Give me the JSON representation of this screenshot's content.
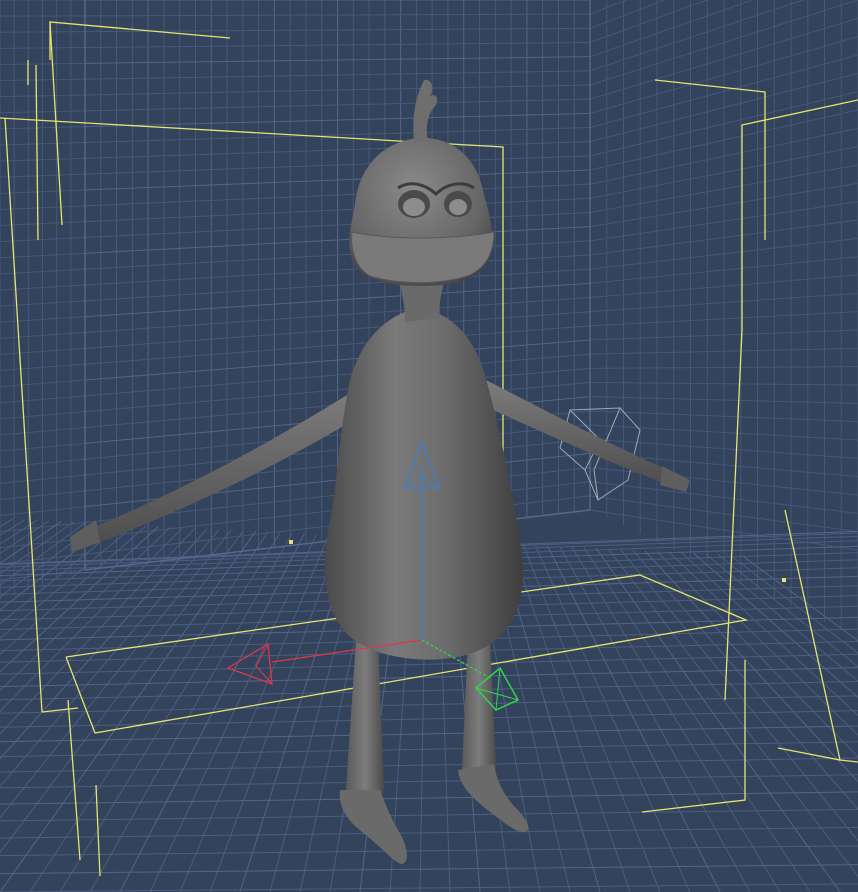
{
  "viewport": {
    "kind": "3d-perspective-viewport",
    "model": "cartoon-bird-character-t-pose",
    "manipulator": "translate-gizmo",
    "selection": "bounding-box"
  },
  "colors": {
    "background": "#34435c",
    "grid_line": "#47597a",
    "grid_line_major": "#52658a",
    "bounding_box": "#e6e46e",
    "model_base": "#6f6f6f",
    "model_light": "#8c8c8c",
    "model_dark": "#3e3e3e",
    "axis_x": "#e0364a",
    "axis_y": "#2fd64b",
    "axis_z": "#3f7fd0",
    "ik_handle": "#b9c0c8"
  },
  "icons": {
    "move_gizmo": "translate-arrows-icon",
    "ik_handle": "ik-target-icon"
  }
}
